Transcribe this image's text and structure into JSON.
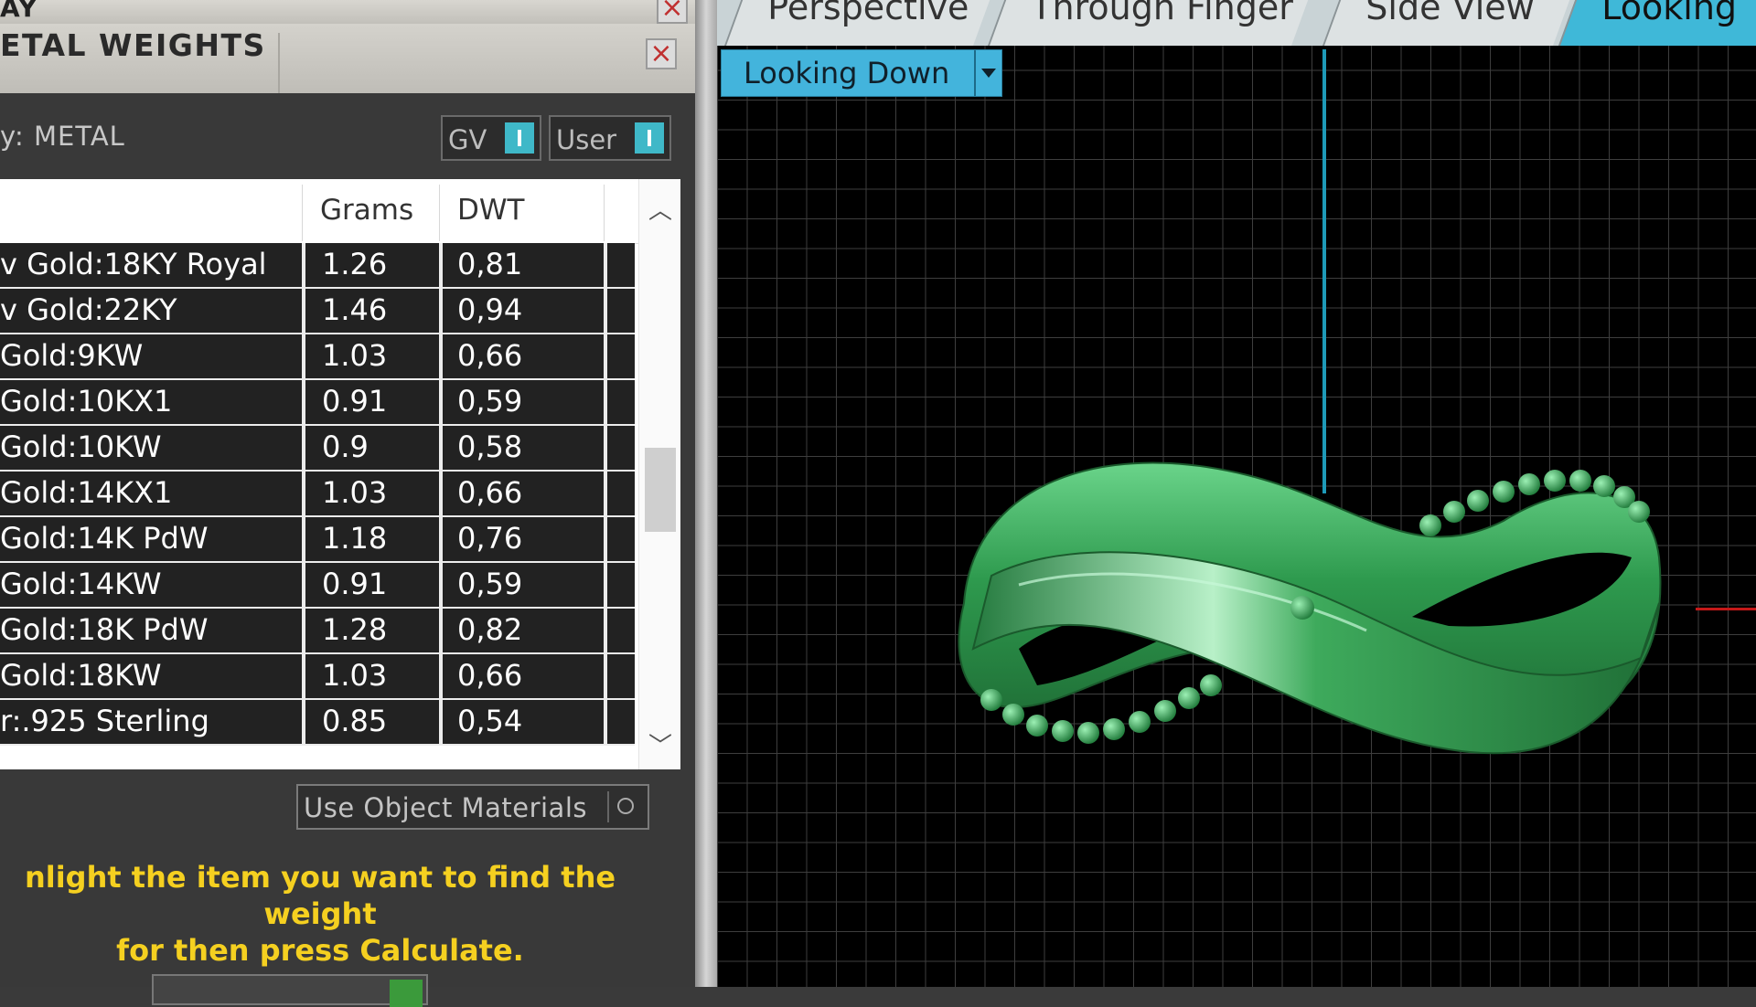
{
  "left_panel": {
    "top_title": "AY",
    "subtitle": "ETAL WEIGHTS",
    "category_label": "y: METAL",
    "toggle_gv": "GV",
    "toggle_user": "User",
    "table": {
      "headers": [
        "",
        "Grams",
        "DWT"
      ],
      "rows": [
        {
          "name": "v Gold:18KY Royal",
          "grams": "1.26",
          "dwt": "0,81"
        },
        {
          "name": "v Gold:22KY",
          "grams": "1.46",
          "dwt": "0,94"
        },
        {
          "name": " Gold:9KW",
          "grams": "1.03",
          "dwt": "0,66"
        },
        {
          "name": " Gold:10KX1",
          "grams": "0.91",
          "dwt": "0,59"
        },
        {
          "name": " Gold:10KW",
          "grams": "0.9",
          "dwt": "0,58"
        },
        {
          "name": " Gold:14KX1",
          "grams": "1.03",
          "dwt": "0,66"
        },
        {
          "name": " Gold:14K PdW",
          "grams": "1.18",
          "dwt": "0,76"
        },
        {
          "name": " Gold:14KW",
          "grams": "0.91",
          "dwt": "0,59"
        },
        {
          "name": " Gold:18K PdW",
          "grams": "1.28",
          "dwt": "0,82"
        },
        {
          "name": " Gold:18KW",
          "grams": "1.03",
          "dwt": "0,66"
        },
        {
          "name": "r:.925 Sterling",
          "grams": "0.85",
          "dwt": "0,54"
        }
      ]
    },
    "use_object_materials": "Use Object Materials",
    "hint_line1": "nlight the item you want to find the weight",
    "hint_line2": "for then press Calculate."
  },
  "viewport": {
    "tabs": [
      {
        "label": "Perspective"
      },
      {
        "label": "Through Finger"
      },
      {
        "label": "Side View"
      },
      {
        "label": "Looking",
        "active": true
      }
    ],
    "view_select": "Looking Down",
    "colors": {
      "accent": "#3fb8d8",
      "model": "#2e9a4e",
      "grid": "#3e3e3e",
      "axis_y": "#1e9ab8",
      "axis_x": "#c41818",
      "hint": "#f5d020"
    }
  }
}
